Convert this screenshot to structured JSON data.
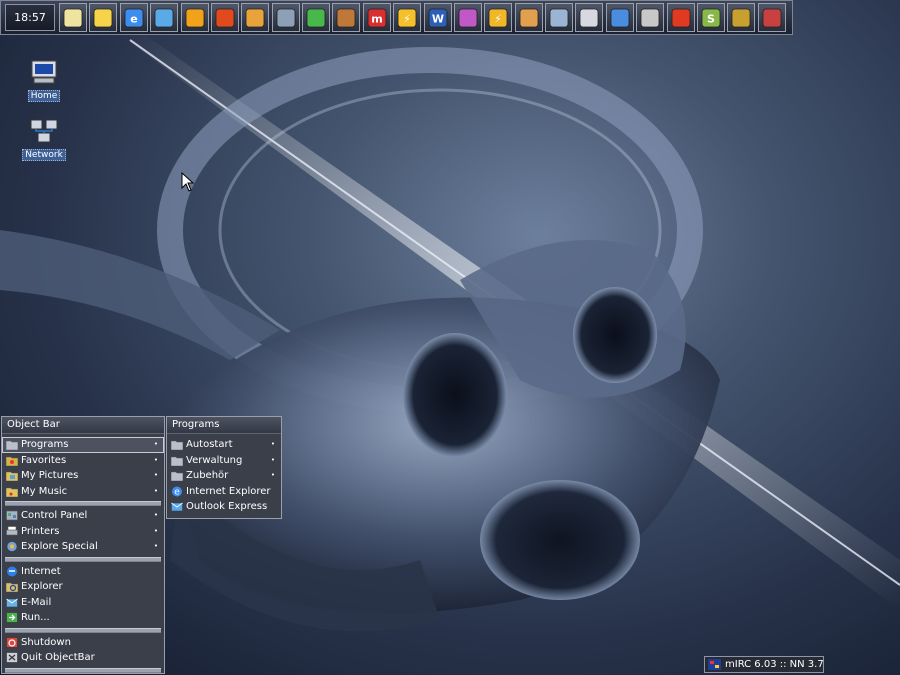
{
  "taskbar": {
    "clock": "18:57",
    "quick_launch": [
      {
        "name": "notepad-icon",
        "glyph": "",
        "color": "#f0e2a0"
      },
      {
        "name": "find-icon",
        "glyph": "",
        "color": "#f5d44a"
      },
      {
        "name": "internet-explorer-icon",
        "glyph": "e",
        "color": "#3d8df0"
      },
      {
        "name": "outlook-express-icon",
        "glyph": "",
        "color": "#5aaae8"
      },
      {
        "name": "media-player-icon",
        "glyph": "",
        "color": "#f2a21a"
      },
      {
        "name": "fire-app-icon",
        "glyph": "",
        "color": "#e04a1c"
      },
      {
        "name": "winamp-icon",
        "glyph": "",
        "color": "#e8a43a"
      },
      {
        "name": "bird-app-icon",
        "glyph": "",
        "color": "#8ca0b8"
      },
      {
        "name": "icq-lite-icon",
        "glyph": "",
        "color": "#49b84a"
      },
      {
        "name": "rabbit-app-icon",
        "glyph": "",
        "color": "#c07838"
      },
      {
        "name": "mirc-icon",
        "glyph": "m",
        "color": "#d83030"
      },
      {
        "name": "lightning-app-icon",
        "glyph": "⚡",
        "color": "#f4c02c"
      },
      {
        "name": "word-icon",
        "glyph": "W",
        "color": "#2b5fb8"
      },
      {
        "name": "color-wheel-icon",
        "glyph": "",
        "color": "#c058c8"
      },
      {
        "name": "lightning-app-2-icon",
        "glyph": "⚡",
        "color": "#f0b828"
      },
      {
        "name": "paint-icon",
        "glyph": "",
        "color": "#e0a050"
      },
      {
        "name": "display-icon",
        "glyph": "",
        "color": "#9cb4d4"
      },
      {
        "name": "write-icon",
        "glyph": "",
        "color": "#d8d8e0"
      },
      {
        "name": "pointer-icon",
        "glyph": "",
        "color": "#4a8ce0"
      },
      {
        "name": "eye-icon",
        "glyph": "",
        "color": "#c8c8c8"
      },
      {
        "name": "flash-app-icon",
        "glyph": "",
        "color": "#e03a20"
      },
      {
        "name": "s-app-icon",
        "glyph": "S",
        "color": "#88b848"
      },
      {
        "name": "compass-app-icon",
        "glyph": "",
        "color": "#c8a030"
      },
      {
        "name": "crest-icon",
        "glyph": "",
        "color": "#c84040"
      }
    ]
  },
  "desktop_icons": [
    {
      "label": "Home"
    },
    {
      "label": "Network"
    }
  ],
  "object_bar": {
    "title": "Object Bar",
    "groups": [
      [
        {
          "label": "Programs",
          "icon": "folder-icon",
          "submenu": true,
          "selected": true
        },
        {
          "label": "Favorites",
          "icon": "favorites-icon",
          "submenu": true
        },
        {
          "label": "My Pictures",
          "icon": "pictures-folder-icon",
          "submenu": true
        },
        {
          "label": "My Music",
          "icon": "music-folder-icon",
          "submenu": true
        }
      ],
      [
        {
          "label": "Control Panel",
          "icon": "control-panel-icon",
          "submenu": true
        },
        {
          "label": "Printers",
          "icon": "printer-icon",
          "submenu": true
        },
        {
          "label": "Explore Special",
          "icon": "explore-special-icon",
          "submenu": true
        }
      ],
      [
        {
          "label": "Internet",
          "icon": "internet-icon",
          "submenu": false
        },
        {
          "label": "Explorer",
          "icon": "explorer-icon",
          "submenu": false
        },
        {
          "label": "E-Mail",
          "icon": "email-icon",
          "submenu": false
        },
        {
          "label": "Run...",
          "icon": "run-icon",
          "submenu": false
        }
      ],
      [
        {
          "label": "Shutdown",
          "icon": "shutdown-icon",
          "submenu": false
        },
        {
          "label": "Quit ObjectBar",
          "icon": "quit-icon",
          "submenu": false
        }
      ]
    ]
  },
  "programs_menu": {
    "title": "Programs",
    "items": [
      {
        "label": "Autostart",
        "icon": "folder-icon",
        "submenu": true
      },
      {
        "label": "Verwaltung",
        "icon": "folder-icon",
        "submenu": true
      },
      {
        "label": "Zubehör",
        "icon": "folder-icon",
        "submenu": true
      },
      {
        "label": "Internet Explorer",
        "icon": "internet-explorer-icon",
        "submenu": false
      },
      {
        "label": "Outlook Express",
        "icon": "outlook-express-icon",
        "submenu": false
      }
    ]
  },
  "tray": {
    "task_label": "mIRC 6.03 :: NN 3.7..."
  },
  "colors": {
    "menu_bg": "#3a3f4a",
    "accent": "#3d5f94"
  }
}
